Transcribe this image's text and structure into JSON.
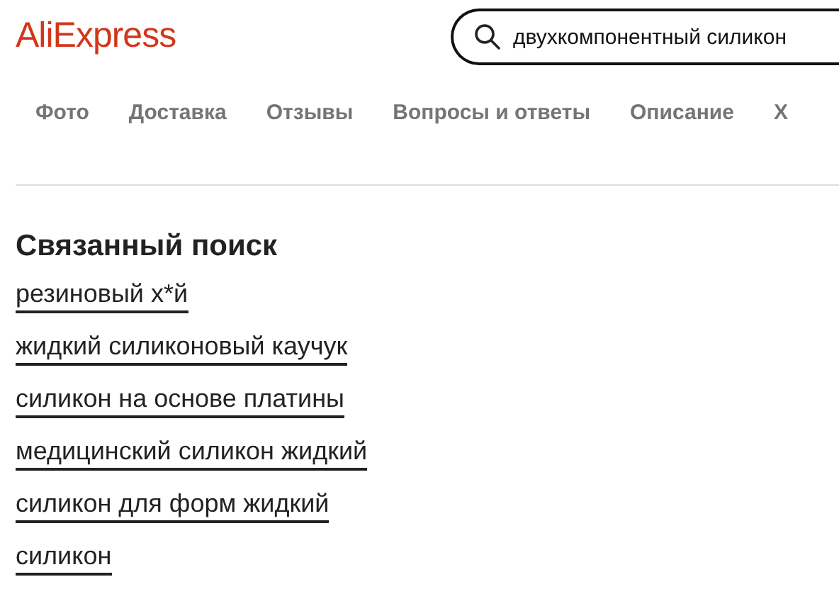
{
  "header": {
    "logo": "AliExpress",
    "search": {
      "value": "двухкомпонентный силикон"
    }
  },
  "nav": [
    "Фото",
    "Доставка",
    "Отзывы",
    "Вопросы и ответы",
    "Описание",
    "Х"
  ],
  "related_search": {
    "title": "Связанный поиск",
    "links": [
      "резиновый х*й",
      "жидкий силиконовый каучук",
      "силикон на основе платины",
      "медицинский силикон жидкий",
      "силикон для форм жидкий",
      "силикон"
    ]
  }
}
